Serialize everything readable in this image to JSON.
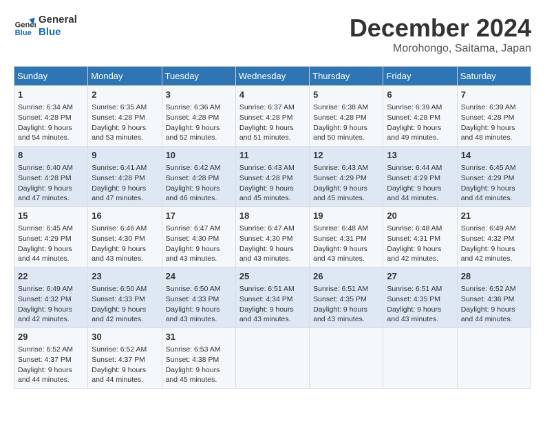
{
  "header": {
    "logo_line1": "General",
    "logo_line2": "Blue",
    "month": "December 2024",
    "location": "Morohongo, Saitama, Japan"
  },
  "days_of_week": [
    "Sunday",
    "Monday",
    "Tuesday",
    "Wednesday",
    "Thursday",
    "Friday",
    "Saturday"
  ],
  "weeks": [
    [
      {
        "day": "1",
        "info": "Sunrise: 6:34 AM\nSunset: 4:28 PM\nDaylight: 9 hours\nand 54 minutes."
      },
      {
        "day": "2",
        "info": "Sunrise: 6:35 AM\nSunset: 4:28 PM\nDaylight: 9 hours\nand 53 minutes."
      },
      {
        "day": "3",
        "info": "Sunrise: 6:36 AM\nSunset: 4:28 PM\nDaylight: 9 hours\nand 52 minutes."
      },
      {
        "day": "4",
        "info": "Sunrise: 6:37 AM\nSunset: 4:28 PM\nDaylight: 9 hours\nand 51 minutes."
      },
      {
        "day": "5",
        "info": "Sunrise: 6:38 AM\nSunset: 4:28 PM\nDaylight: 9 hours\nand 50 minutes."
      },
      {
        "day": "6",
        "info": "Sunrise: 6:39 AM\nSunset: 4:28 PM\nDaylight: 9 hours\nand 49 minutes."
      },
      {
        "day": "7",
        "info": "Sunrise: 6:39 AM\nSunset: 4:28 PM\nDaylight: 9 hours\nand 48 minutes."
      }
    ],
    [
      {
        "day": "8",
        "info": "Sunrise: 6:40 AM\nSunset: 4:28 PM\nDaylight: 9 hours\nand 47 minutes."
      },
      {
        "day": "9",
        "info": "Sunrise: 6:41 AM\nSunset: 4:28 PM\nDaylight: 9 hours\nand 47 minutes."
      },
      {
        "day": "10",
        "info": "Sunrise: 6:42 AM\nSunset: 4:28 PM\nDaylight: 9 hours\nand 46 minutes."
      },
      {
        "day": "11",
        "info": "Sunrise: 6:43 AM\nSunset: 4:28 PM\nDaylight: 9 hours\nand 45 minutes."
      },
      {
        "day": "12",
        "info": "Sunrise: 6:43 AM\nSunset: 4:29 PM\nDaylight: 9 hours\nand 45 minutes."
      },
      {
        "day": "13",
        "info": "Sunrise: 6:44 AM\nSunset: 4:29 PM\nDaylight: 9 hours\nand 44 minutes."
      },
      {
        "day": "14",
        "info": "Sunrise: 6:45 AM\nSunset: 4:29 PM\nDaylight: 9 hours\nand 44 minutes."
      }
    ],
    [
      {
        "day": "15",
        "info": "Sunrise: 6:45 AM\nSunset: 4:29 PM\nDaylight: 9 hours\nand 44 minutes."
      },
      {
        "day": "16",
        "info": "Sunrise: 6:46 AM\nSunset: 4:30 PM\nDaylight: 9 hours\nand 43 minutes."
      },
      {
        "day": "17",
        "info": "Sunrise: 6:47 AM\nSunset: 4:30 PM\nDaylight: 9 hours\nand 43 minutes."
      },
      {
        "day": "18",
        "info": "Sunrise: 6:47 AM\nSunset: 4:30 PM\nDaylight: 9 hours\nand 43 minutes."
      },
      {
        "day": "19",
        "info": "Sunrise: 6:48 AM\nSunset: 4:31 PM\nDaylight: 9 hours\nand 43 minutes."
      },
      {
        "day": "20",
        "info": "Sunrise: 6:48 AM\nSunset: 4:31 PM\nDaylight: 9 hours\nand 42 minutes."
      },
      {
        "day": "21",
        "info": "Sunrise: 6:49 AM\nSunset: 4:32 PM\nDaylight: 9 hours\nand 42 minutes."
      }
    ],
    [
      {
        "day": "22",
        "info": "Sunrise: 6:49 AM\nSunset: 4:32 PM\nDaylight: 9 hours\nand 42 minutes."
      },
      {
        "day": "23",
        "info": "Sunrise: 6:50 AM\nSunset: 4:33 PM\nDaylight: 9 hours\nand 42 minutes."
      },
      {
        "day": "24",
        "info": "Sunrise: 6:50 AM\nSunset: 4:33 PM\nDaylight: 9 hours\nand 43 minutes."
      },
      {
        "day": "25",
        "info": "Sunrise: 6:51 AM\nSunset: 4:34 PM\nDaylight: 9 hours\nand 43 minutes."
      },
      {
        "day": "26",
        "info": "Sunrise: 6:51 AM\nSunset: 4:35 PM\nDaylight: 9 hours\nand 43 minutes."
      },
      {
        "day": "27",
        "info": "Sunrise: 6:51 AM\nSunset: 4:35 PM\nDaylight: 9 hours\nand 43 minutes."
      },
      {
        "day": "28",
        "info": "Sunrise: 6:52 AM\nSunset: 4:36 PM\nDaylight: 9 hours\nand 44 minutes."
      }
    ],
    [
      {
        "day": "29",
        "info": "Sunrise: 6:52 AM\nSunset: 4:37 PM\nDaylight: 9 hours\nand 44 minutes."
      },
      {
        "day": "30",
        "info": "Sunrise: 6:52 AM\nSunset: 4:37 PM\nDaylight: 9 hours\nand 44 minutes."
      },
      {
        "day": "31",
        "info": "Sunrise: 6:53 AM\nSunset: 4:38 PM\nDaylight: 9 hours\nand 45 minutes."
      },
      {
        "day": "",
        "info": ""
      },
      {
        "day": "",
        "info": ""
      },
      {
        "day": "",
        "info": ""
      },
      {
        "day": "",
        "info": ""
      }
    ]
  ]
}
